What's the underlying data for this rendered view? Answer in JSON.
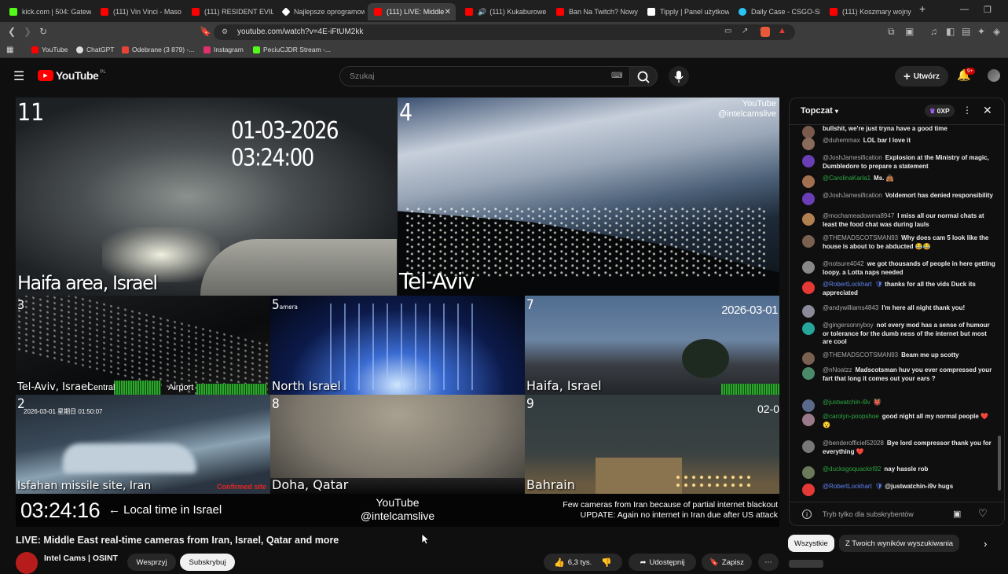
{
  "browser": {
    "tabs": [
      {
        "title": "kick.com | 504: Gatewa",
        "color": "#53fc18"
      },
      {
        "title": "(111) Vin Vinci - Maso",
        "color": "#ff0000"
      },
      {
        "title": "(111) RESIDENT EVIL 9",
        "color": "#ff0000"
      },
      {
        "title": "Najlepsze oprogramow",
        "color": "#ffffff"
      },
      {
        "title": "(111) LIVE: Middle",
        "color": "#ff0000",
        "active": true
      },
      {
        "title": "(111) Kukaburowe",
        "color": "#ff0000"
      },
      {
        "title": "Ban Na Twitch? Nowy",
        "color": "#ff0000"
      },
      {
        "title": "Tipply | Panel użytkow",
        "color": "#ffffff"
      },
      {
        "title": "Daily Case - CSGO-SKI",
        "color": "#27c4f5"
      },
      {
        "title": "(111) Koszmary wojny",
        "color": "#ff0000"
      }
    ],
    "new_tab": "+",
    "url": "youtube.com/watch?v=4E-iFtUM2kk",
    "bookmarks": [
      {
        "label": "YouTube",
        "color": "#ff0000"
      },
      {
        "label": "ChatGPT",
        "color": "#dddddd"
      },
      {
        "label": "Odebrane (3 879) -...",
        "color": "#ea4335"
      },
      {
        "label": "Instagram",
        "color": "#e1306c"
      },
      {
        "label": "PeciuCJDR Stream -...",
        "color": "#53fc18"
      }
    ]
  },
  "header": {
    "logo": "YouTube",
    "logo_region": "PL",
    "search_placeholder": "Szukaj",
    "create_label": "Utwórz",
    "notif_badge": "9+"
  },
  "video": {
    "cams": [
      {
        "num": "11",
        "loc": "Haifa area, Israel",
        "ts": "01-03-2026 03:24:00"
      },
      {
        "num": "4",
        "loc": "Tel-Aviv",
        "wm": "YouTube\n@intelcamslive"
      },
      {
        "num": "3",
        "loc": "Tel-Aviv, Israel",
        "extra1": "Central",
        "extra2": "Airport"
      },
      {
        "num": "5",
        "loc": "North Israel",
        "sub": "amera"
      },
      {
        "num": "7",
        "loc": "Haifa, Israel",
        "ts": "2026-03-01"
      },
      {
        "num": "2",
        "loc": "Isfahan missile site, Iran",
        "ts": "2026-03-01  星期日  01:50:07",
        "confirmed": "Confirmed site"
      },
      {
        "num": "8",
        "loc": "Doha, Qatar"
      },
      {
        "num": "9",
        "loc": "Bahrain",
        "ts": "02-0"
      }
    ],
    "clock": "03:24:16",
    "clock_caption": "← Local time in Israel",
    "watermark_line1": "YouTube",
    "watermark_line2": "@intelcamslive",
    "notice_line1": "Few cameras from Iran because of partial internet blackout",
    "notice_line2": "UPDATE: Again no internet in Iran due after US attack"
  },
  "below": {
    "title": "LIVE: Middle East real-time cameras from Iran, Israel, Qatar and more",
    "channel": "Intel Cams | OSINT",
    "join": "Wesprzyj",
    "subscribe": "Subskrybuj",
    "likes": "6,3 tys.",
    "share": "Udostępnij",
    "save": "Zapisz"
  },
  "chips": [
    "Wszystkie",
    "Z Twoich wyników wyszukiwania"
  ],
  "chat": {
    "mode": "Topczat",
    "xp": "0XP",
    "input_placeholder": "Tryb tylko dla subskrybentów",
    "messages": [
      {
        "author": "",
        "text": "bullshit, we're just tryna have a good time",
        "av": "#7a5a4a",
        "cls": ""
      },
      {
        "author": "@duhemmax",
        "text": "LOL bar I love it",
        "av": "#8a6a5a",
        "cls": ""
      },
      {
        "author": "@JoshJamesification",
        "text": "Explosion at the Ministry of magic, Dumbledore to prepare a statement",
        "av": "#6a3fb5",
        "cls": ""
      },
      {
        "author": "@CarolinaKarla1",
        "text": "Ms. 👜",
        "av": "#a07050",
        "cls": "member"
      },
      {
        "author": "@JoshJamesification",
        "text": "Voldemort has denied responsibility",
        "av": "#6a3fb5",
        "cls": ""
      },
      {
        "author": "@mochameadowma8947",
        "text": "I miss all our normal chats at least the food chat was during lauls",
        "av": "#b08050",
        "cls": ""
      },
      {
        "author": "@THEMADSCOTSMAN93",
        "text": "Why does cam 5 look like the house is about to be abducted 😂😂",
        "av": "#7a6050",
        "cls": ""
      },
      {
        "author": "@notsure4042",
        "text": "we got thousands of people in here getting loopy. a Lotta naps needed",
        "av": "#888",
        "cls": ""
      },
      {
        "author": "@RobertLockhart",
        "text": "thanks for all the vids Duck its appreciated",
        "av": "#e53935",
        "cls": "mod"
      },
      {
        "author": "@andywilliams4843",
        "text": "I'm here all night thank you!",
        "av": "#8a8a9a",
        "cls": ""
      },
      {
        "author": "@gingersonnyboy",
        "text": "not every mod has a sense of humour or tolerance for the dumb ness of the internet but most are cool",
        "av": "#26a69a",
        "cls": ""
      },
      {
        "author": "@THEMADSCOTSMAN93",
        "text": "Beam me up scotty",
        "av": "#7a6050",
        "cls": ""
      },
      {
        "author": "@nNoatzz",
        "text": "Madscotsman huv you ever compressed your fart that long it comes out your ears ?",
        "av": "#4a8a6a",
        "cls": ""
      },
      {
        "author": "@justwatchin-i9v",
        "text": "👹",
        "av": "#5a6a8a",
        "cls": "member"
      },
      {
        "author": "@carolyn-poopshoe",
        "text": "good night all my normal people ❤️😯",
        "av": "#9a7a8a",
        "cls": "member"
      },
      {
        "author": "@benderofficiel52028",
        "text": "Bye lord compressor thank you for everything ❤️",
        "av": "#777",
        "cls": ""
      },
      {
        "author": "@ducksgoquackirl92",
        "text": "nay hassle rob",
        "av": "#6a7a5a",
        "cls": "member"
      },
      {
        "author": "@RobertLockhart",
        "text": "@justwatchin-i9v hugs",
        "av": "#e53935",
        "cls": "mod"
      }
    ]
  }
}
